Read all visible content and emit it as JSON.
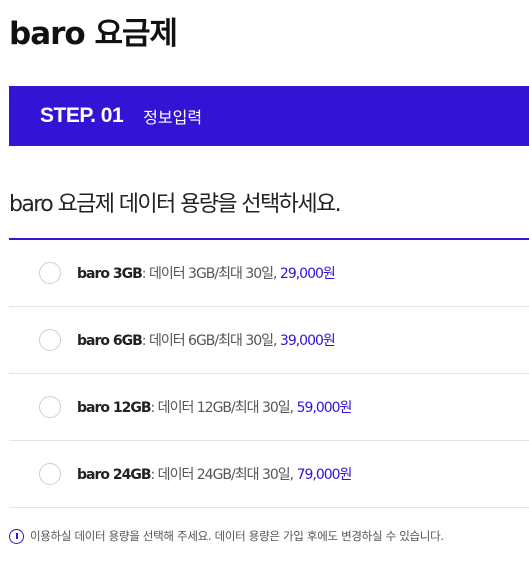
{
  "page": {
    "title": "baro 요금제"
  },
  "step": {
    "number": "STEP. 01",
    "label": "정보입력"
  },
  "question": "baro 요금제 데이터 용량을 선택하세요.",
  "plans": [
    {
      "name": "baro 3GB",
      "desc": ": 데이터 3GB/최대 30일, ",
      "price": "29,000원"
    },
    {
      "name": "baro 6GB",
      "desc": ": 데이터 6GB/최대 30일, ",
      "price": "39,000원"
    },
    {
      "name": "baro 12GB",
      "desc": ": 데이터 12GB/최대 30일, ",
      "price": "59,000원"
    },
    {
      "name": "baro 24GB",
      "desc": ": 데이터 24GB/최대 30일, ",
      "price": "79,000원"
    }
  ],
  "notice": "이용하실 데이터 용량을 선택해 주세요. 데이터 용량은 가입 후에도 변경하실 수 있습니다.",
  "colors": {
    "accent": "#3314d4",
    "divider": "#e3e3e3"
  },
  "icons": {
    "radio": "radio-unchecked",
    "notice": "info-icon"
  }
}
